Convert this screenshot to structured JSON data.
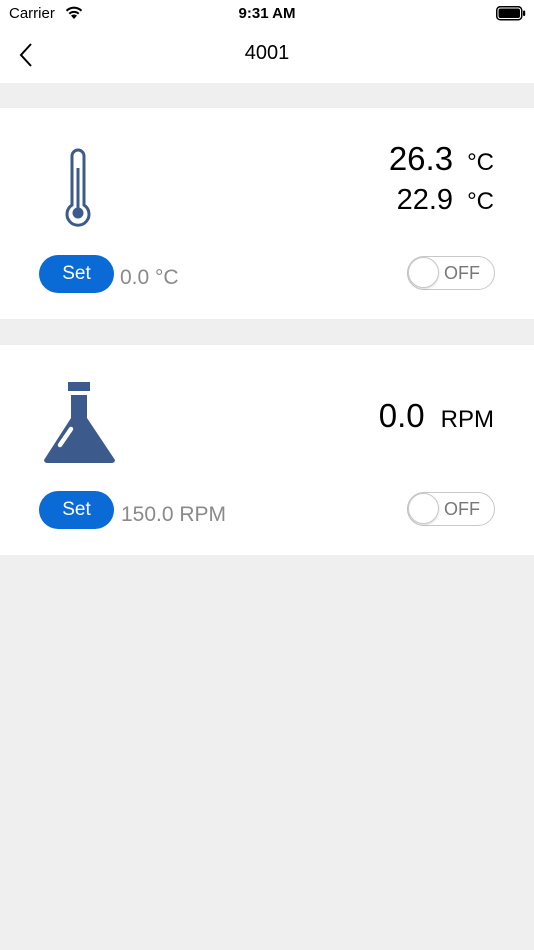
{
  "status_bar": {
    "carrier": "Carrier",
    "time": "9:31 AM"
  },
  "nav": {
    "title": "4001",
    "back_icon": "chevron-left-icon"
  },
  "temperature_card": {
    "icon": "thermometer-icon",
    "icon_color": "#3c5a8c",
    "reading_primary": "26.3",
    "reading_primary_unit": "°C",
    "reading_secondary": "22.9",
    "reading_secondary_unit": "°C",
    "set_label": "Set",
    "set_value": "0.0 °C",
    "toggle_label": "OFF",
    "toggle_on": false
  },
  "speed_card": {
    "icon": "flask-icon",
    "icon_color": "#3c5a8c",
    "reading": "0.0",
    "reading_unit": "RPM",
    "set_label": "Set",
    "set_value": "150.0 RPM",
    "toggle_label": "OFF",
    "toggle_on": false
  },
  "colors": {
    "accent": "#0a6ad6",
    "background": "#efefef"
  }
}
